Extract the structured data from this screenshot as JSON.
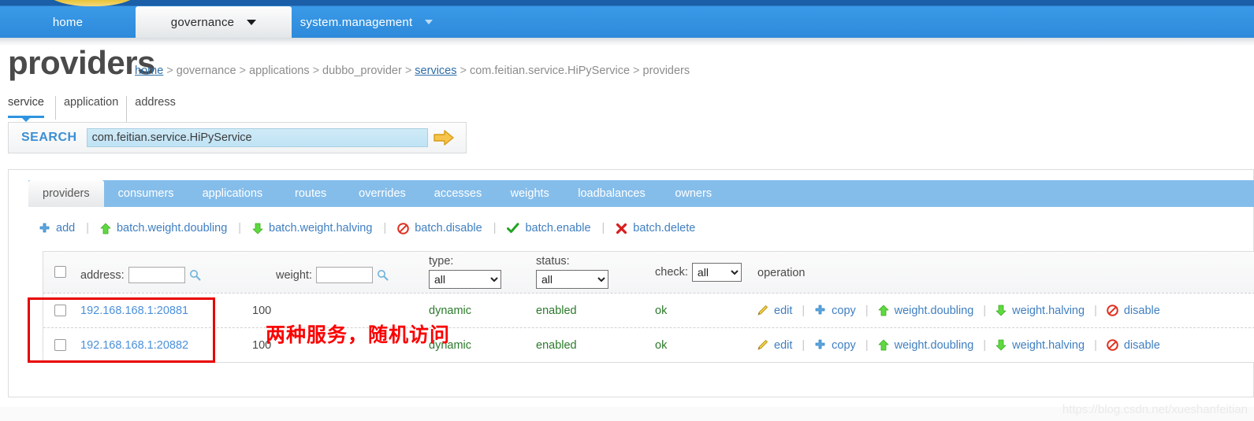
{
  "topnav": {
    "tabs": [
      {
        "label": "home",
        "active": false,
        "caret": false
      },
      {
        "label": "governance",
        "active": true,
        "caret": true
      },
      {
        "label": "system.management",
        "active": false,
        "caret": true
      }
    ]
  },
  "page": {
    "title": "providers"
  },
  "breadcrumb": {
    "items": [
      {
        "label": "home",
        "link": true
      },
      {
        "label": "governance",
        "link": false
      },
      {
        "label": "applications",
        "link": false
      },
      {
        "label": "dubbo_provider",
        "link": false
      },
      {
        "label": "services",
        "link": true
      },
      {
        "label": "com.feitian.service.HiPyService",
        "link": false
      },
      {
        "label": "providers",
        "link": false
      }
    ],
    "separator": ">"
  },
  "subtabs": {
    "items": [
      {
        "label": "service",
        "active": true
      },
      {
        "label": "application",
        "active": false
      },
      {
        "label": "address",
        "active": false
      }
    ]
  },
  "search": {
    "label": "SEARCH",
    "value": "com.feitian.service.HiPyService",
    "placeholder": "",
    "go_icon": "arrow-right-icon"
  },
  "panel_tabs": {
    "items": [
      {
        "label": "providers",
        "active": true
      },
      {
        "label": "consumers",
        "active": false
      },
      {
        "label": "applications",
        "active": false
      },
      {
        "label": "routes",
        "active": false
      },
      {
        "label": "overrides",
        "active": false
      },
      {
        "label": "accesses",
        "active": false
      },
      {
        "label": "weights",
        "active": false
      },
      {
        "label": "loadbalances",
        "active": false
      },
      {
        "label": "owners",
        "active": false
      }
    ]
  },
  "batch_actions": [
    {
      "label": "add",
      "icon": "plus-icon"
    },
    {
      "label": "batch.weight.doubling",
      "icon": "arrow-up-icon"
    },
    {
      "label": "batch.weight.halving",
      "icon": "arrow-down-icon"
    },
    {
      "label": "batch.disable",
      "icon": "no-entry-icon"
    },
    {
      "label": "batch.enable",
      "icon": "check-icon"
    },
    {
      "label": "batch.delete",
      "icon": "cross-icon"
    }
  ],
  "batch_separator": "|",
  "table": {
    "headers": {
      "select_all": "",
      "address_label": "address:",
      "address_filter": "",
      "address_search_icon": "magnifier-icon",
      "weight_label": "weight:",
      "weight_filter": "",
      "weight_search_icon": "magnifier-icon",
      "type_label": "type:",
      "type_value": "all",
      "status_label": "status:",
      "status_value": "all",
      "check_label": "check:",
      "check_value": "all",
      "operation_label": "operation"
    },
    "select_options": [
      "all"
    ],
    "rows": [
      {
        "checked": false,
        "address": "192.168.168.1:20881",
        "weight": "100",
        "type": "dynamic",
        "status": "enabled",
        "check": "ok",
        "operations": [
          {
            "label": "edit",
            "icon": "pencil-icon"
          },
          {
            "label": "copy",
            "icon": "plus-icon"
          },
          {
            "label": "weight.doubling",
            "icon": "arrow-up-icon"
          },
          {
            "label": "weight.halving",
            "icon": "arrow-down-icon"
          },
          {
            "label": "disable",
            "icon": "no-entry-icon"
          }
        ]
      },
      {
        "checked": false,
        "address": "192.168.168.1:20882",
        "weight": "100",
        "type": "dynamic",
        "status": "enabled",
        "check": "ok",
        "operations": [
          {
            "label": "edit",
            "icon": "pencil-icon"
          },
          {
            "label": "copy",
            "icon": "plus-icon"
          },
          {
            "label": "weight.doubling",
            "icon": "arrow-up-icon"
          },
          {
            "label": "weight.halving",
            "icon": "arrow-down-icon"
          },
          {
            "label": "disable",
            "icon": "no-entry-icon"
          }
        ]
      }
    ],
    "op_separator": "|"
  },
  "annotation": {
    "text": "两种服务，随机访问",
    "color": "#fb0000"
  },
  "watermark": {
    "text": "https://blog.csdn.net/xueshanfeitian"
  },
  "colors": {
    "nav_blue": "#2e8ada",
    "tab_blue": "#85bdea",
    "link_blue": "#3f7fc1",
    "address_blue": "#4a90d9",
    "status_green": "#2b7a2b",
    "annotation_red": "#fb0000"
  }
}
